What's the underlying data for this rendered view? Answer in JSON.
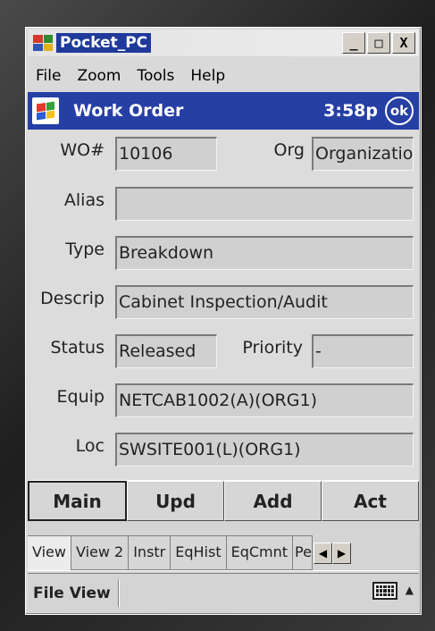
{
  "window": {
    "title": "Pocket_PC",
    "buttons": {
      "minimize": "_",
      "maximize": "□",
      "close": "X"
    }
  },
  "menu": [
    "File",
    "Zoom",
    "Tools",
    "Help"
  ],
  "header": {
    "title": "Work Order",
    "time": "3:58p",
    "ok_label": "ok"
  },
  "form": {
    "wo_label": "WO#",
    "wo_value": "10106",
    "org_label": "Org",
    "org_value": "Organizatio",
    "alias_label": "Alias",
    "alias_value": "",
    "type_label": "Type",
    "type_value": "Breakdown",
    "descrip_label": "Descrip",
    "descrip_value": "Cabinet Inspection/Audit",
    "status_label": "Status",
    "status_value": "Released",
    "priority_label": "Priority",
    "priority_value": "-",
    "equip_label": "Equip",
    "equip_value": "NETCAB1002(A)(ORG1)",
    "loc_label": "Loc",
    "loc_value": "SWSITE001(L)(ORG1)"
  },
  "buttons": [
    "Main",
    "Upd",
    "Add",
    "Act"
  ],
  "tabs": [
    "View",
    "View 2",
    "Instr",
    "EqHist",
    "EqCmnt",
    "Pe"
  ],
  "bottom_menu": [
    "File",
    "View"
  ],
  "icons": {
    "app": "windows-flag-icon",
    "keyboard": "keyboard-icon",
    "scroll_left": "left-arrow-icon",
    "scroll_right": "right-arrow-icon"
  },
  "colors": {
    "header_bg": "#263fa5",
    "form_bg": "#dcdcdc"
  }
}
